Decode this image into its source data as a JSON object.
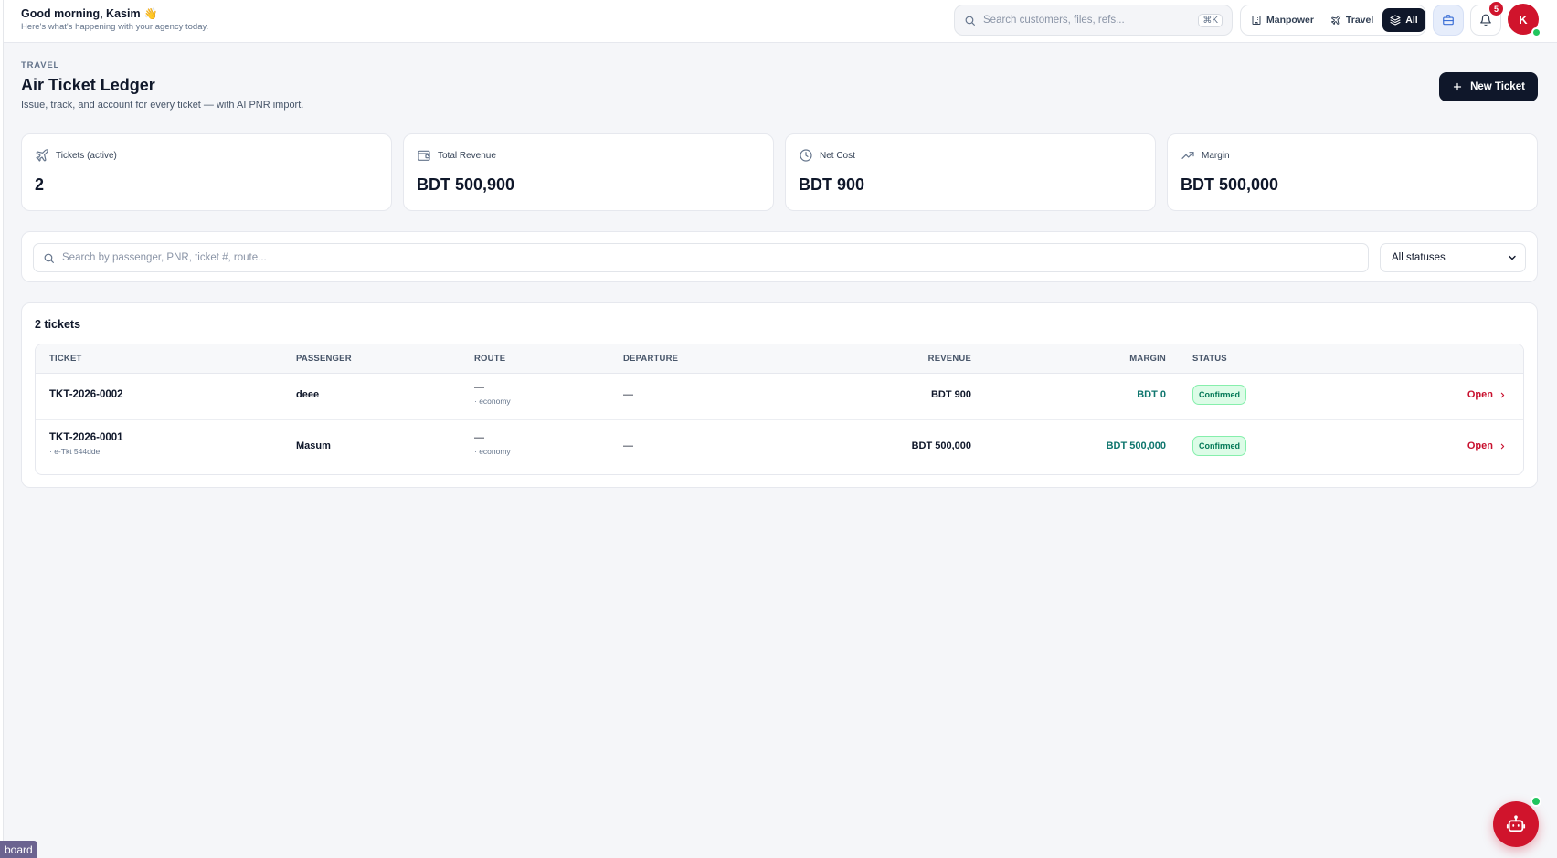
{
  "header": {
    "greeting": "Good morning, Kasim",
    "greeting_emoji": "👋",
    "subtitle": "Here's what's happening with your agency today.",
    "search_placeholder": "Search customers, files, refs...",
    "search_shortcut": "⌘K",
    "segments": [
      {
        "label": "Manpower",
        "icon": "building-icon",
        "active": false
      },
      {
        "label": "Travel",
        "icon": "plane-icon",
        "active": false
      },
      {
        "label": "All",
        "icon": "layers-icon",
        "active": true
      }
    ],
    "notification_count": "5",
    "avatar_initial": "K"
  },
  "page": {
    "eyebrow": "TRAVEL",
    "title": "Air Ticket Ledger",
    "subtitle": "Issue, track, and account for every ticket — with AI PNR import.",
    "new_button_label": "New Ticket"
  },
  "stats": [
    {
      "label": "Tickets (active)",
      "value": "2",
      "icon": "plane-icon"
    },
    {
      "label": "Total Revenue",
      "value": "BDT 500,900",
      "icon": "wallet-icon"
    },
    {
      "label": "Net Cost",
      "value": "BDT 900",
      "icon": "clock-icon"
    },
    {
      "label": "Margin",
      "value": "BDT 500,000",
      "icon": "trending-up-icon"
    }
  ],
  "filters": {
    "search_placeholder": "Search by passenger, PNR, ticket #, route...",
    "status_selected": "All statuses"
  },
  "table": {
    "count_label": "2 tickets",
    "columns": [
      "TICKET",
      "PASSENGER",
      "ROUTE",
      "DEPARTURE",
      "REVENUE",
      "MARGIN",
      "STATUS"
    ],
    "rows": [
      {
        "ticket": "TKT-2026-0002",
        "ticket_sub": "",
        "passenger": "deee",
        "route": "—",
        "route_class": "· economy",
        "departure": "—",
        "revenue": "BDT 900",
        "margin": "BDT 0",
        "status": "Confirmed",
        "action": "Open"
      },
      {
        "ticket": "TKT-2026-0001",
        "ticket_sub": "· e-Tkt 544dde",
        "passenger": "Masum",
        "route": "—",
        "route_class": "· economy",
        "departure": "—",
        "revenue": "BDT 500,000",
        "margin": "BDT 500,000",
        "status": "Confirmed",
        "action": "Open"
      }
    ]
  },
  "footer": {
    "dashboard_tag": "board"
  },
  "colors": {
    "primary_dark": "#0f172a",
    "accent_red": "#d0142c",
    "success_green": "#047857",
    "margin_teal": "#0f766e",
    "background": "#f5f6f9"
  }
}
